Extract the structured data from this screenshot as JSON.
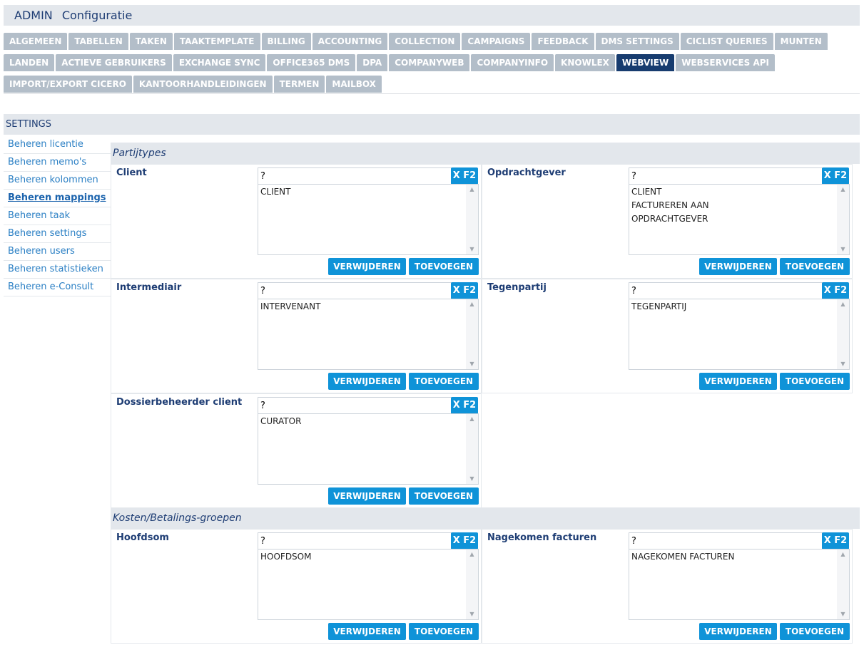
{
  "header": {
    "app": "ADMIN",
    "title": "Configuratie"
  },
  "tabs": {
    "row1": [
      "ALGEMEEN",
      "TABELLEN",
      "TAKEN",
      "TAAKTEMPLATE",
      "BILLING",
      "ACCOUNTING",
      "COLLECTION",
      "CAMPAIGNS",
      "FEEDBACK",
      "DMS SETTINGS",
      "CICLIST QUERIES",
      "MUNTEN"
    ],
    "row2": [
      "LANDEN",
      "ACTIEVE GEBRUIKERS",
      "EXCHANGE SYNC",
      "OFFICE365 DMS",
      "DPA",
      "COMPANYWEB",
      "COMPANYINFO",
      "KNOWLEX",
      "WEBVIEW",
      "WEBSERVICES API"
    ],
    "row3": [
      "IMPORT/EXPORT CICERO",
      "KANTOORHANDLEIDINGEN",
      "TERMEN",
      "MAILBOX"
    ],
    "active": "WEBVIEW"
  },
  "settings": {
    "title": "SETTINGS"
  },
  "sidebar": {
    "items": [
      "Beheren licentie",
      "Beheren memo's",
      "Beheren kolommen",
      "Beheren mappings",
      "Beheren taak",
      "Beheren settings",
      "Beheren users",
      "Beheren statistieken",
      "Beheren e-Consult"
    ],
    "active": "Beheren mappings"
  },
  "common": {
    "search_value": "?",
    "xf2_label": "X F2",
    "remove_label": "VERWIJDEREN",
    "add_label": "TOEVOEGEN"
  },
  "sections": {
    "partijtypes": {
      "title": "Partijtypes",
      "cells": [
        {
          "label": "Client",
          "options": [
            "CLIENT"
          ]
        },
        {
          "label": "Opdrachtgever",
          "options": [
            "CLIENT",
            "FACTUREREN AAN",
            "OPDRACHTGEVER"
          ]
        },
        {
          "label": "Intermediair",
          "options": [
            "INTERVENANT"
          ]
        },
        {
          "label": "Tegenpartij",
          "options": [
            "TEGENPARTIJ"
          ]
        },
        {
          "label": "Dossierbeheerder client",
          "options": [
            "CURATOR"
          ]
        }
      ]
    },
    "kosten": {
      "title": "Kosten/Betalings-groepen",
      "cells": [
        {
          "label": "Hoofdsom",
          "options": [
            "HOOFDSOM"
          ]
        },
        {
          "label": "Nagekomen facturen",
          "options": [
            "NAGEKOMEN FACTUREN"
          ]
        }
      ]
    }
  }
}
